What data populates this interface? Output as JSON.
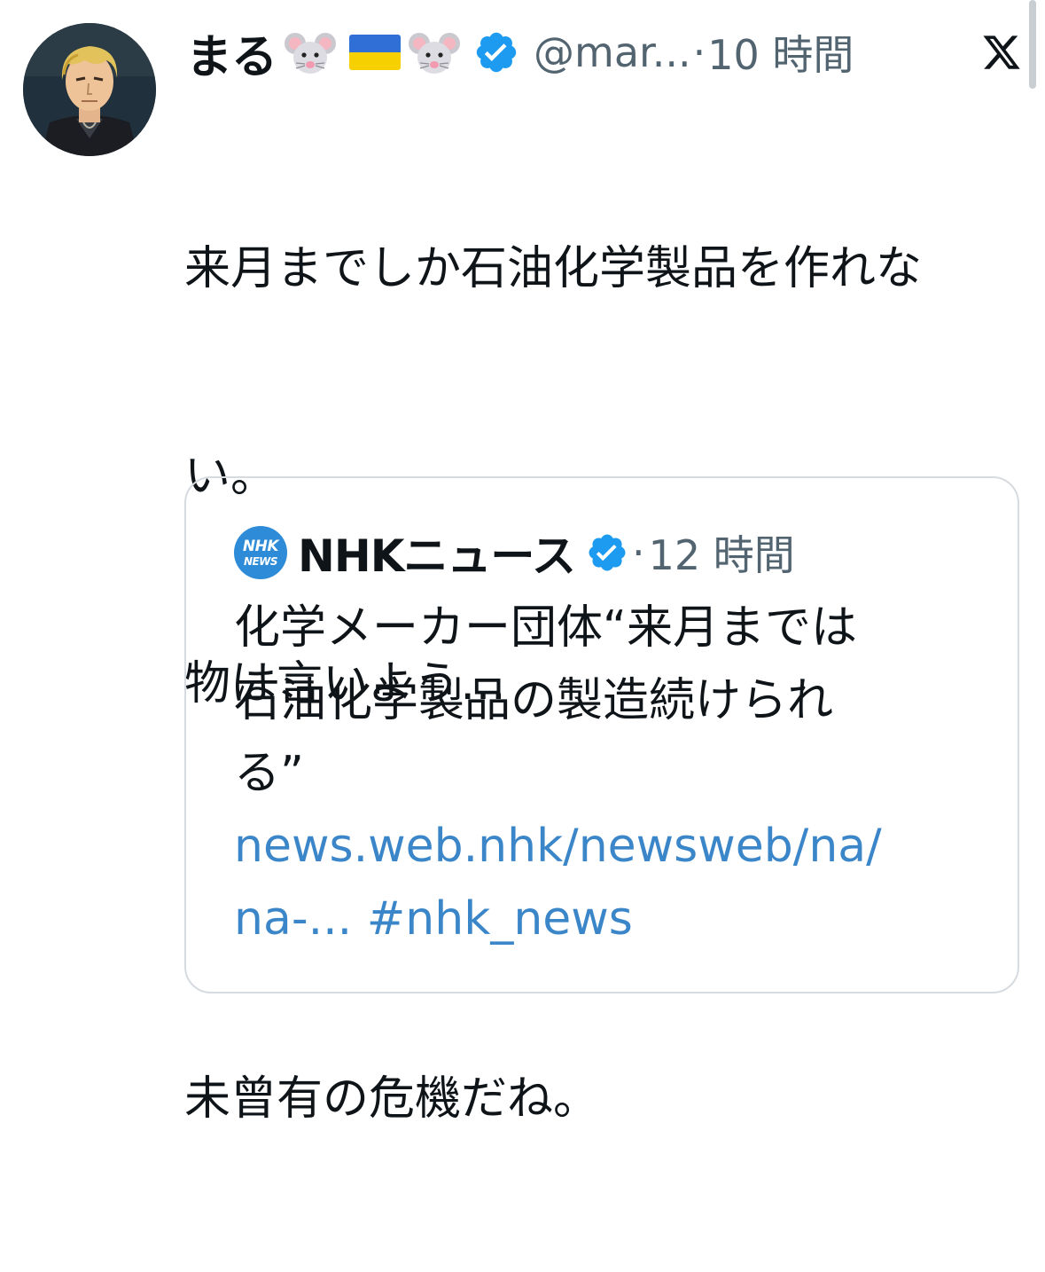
{
  "tweet": {
    "display_name": "まる",
    "emojis": [
      "mouse-face-emoji",
      "ukraine-flag-emoji",
      "mouse-face-emoji"
    ],
    "handle": "@mar...",
    "separator": "·",
    "time": "10 時間",
    "text_lines": [
      "来月までしか石油化学製品を作れな",
      "い。",
      "物は言いよう…",
      "",
      "未曾有の危機だね。"
    ]
  },
  "quote": {
    "source_name": "NHKニュース",
    "logo_line1": "NHK",
    "logo_line2": "NEWS",
    "separator": "·",
    "time": "12 時間",
    "text_lines": [
      "化学メーカー団体“来月までは",
      "石油化学製品の製造続けられ",
      "る”"
    ],
    "link_line1": "news.web.nhk/newsweb/na/",
    "link_line2": "na-...",
    "hashtag": "#nhk_news"
  },
  "colors": {
    "text": "#0f1419",
    "secondary": "#536471",
    "link": "#3a86c9",
    "verified": "#1d9bf0",
    "border": "#d6dbe0",
    "nhk_blue": "#2d8bd8"
  }
}
